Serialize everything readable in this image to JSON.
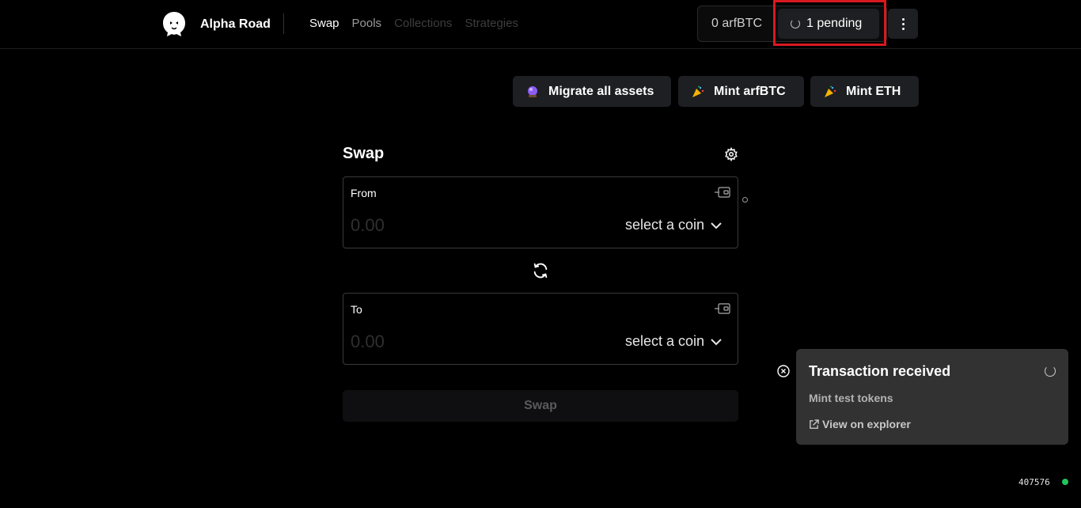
{
  "app": {
    "name": "Alpha Road",
    "logo_icon": "lion-head-icon"
  },
  "nav": {
    "items": [
      {
        "label": "Swap"
      },
      {
        "label": "Pools"
      },
      {
        "label": "Collections"
      },
      {
        "label": "Strategies"
      }
    ]
  },
  "wallet": {
    "balance": "0 arfBTC",
    "pending_label": "1 pending"
  },
  "actions": {
    "migrate_label": "Migrate all assets",
    "mint_btc_label": "Mint arfBTC",
    "mint_eth_label": "Mint ETH"
  },
  "swap": {
    "title": "Swap",
    "from": {
      "label": "From",
      "placeholder": "0.00",
      "coin_label": "select a coin"
    },
    "to": {
      "label": "To",
      "placeholder": "0.00",
      "coin_label": "select a coin"
    },
    "submit_label": "Swap"
  },
  "toast": {
    "title": "Transaction received",
    "subtitle": "Mint test tokens",
    "link_label": "View on explorer"
  },
  "footer": {
    "block_number": "407576",
    "status_color": "#22c55e"
  },
  "colors": {
    "highlight": "#d71920",
    "background": "#000000",
    "button_bg": "#1e1f22",
    "toast_bg": "#323232"
  }
}
